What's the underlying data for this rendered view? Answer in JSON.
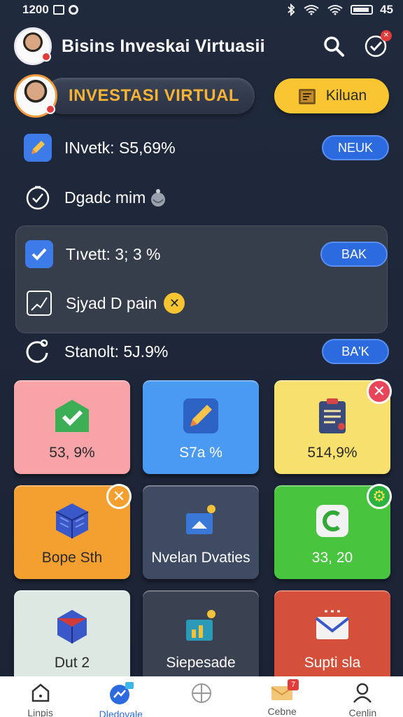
{
  "status_bar": {
    "time": "1200",
    "battery": "45"
  },
  "header": {
    "title": "Bisins Inveskai Virtuasii"
  },
  "banner": {
    "pill_text": "INVESTASI VIRTUAL",
    "button_label": "Kiluan"
  },
  "rows": [
    {
      "label": "INvetk: S5,69%",
      "button": "NEUK"
    },
    {
      "label": "Dgadc mim",
      "button": null
    },
    {
      "label": "Tıvett: 3; 3 %",
      "button": "BAK"
    },
    {
      "label": "Sjyad D pain",
      "button": null
    },
    {
      "label": "Stanolt: 5J.9%",
      "button": "BA'K"
    }
  ],
  "tiles": [
    {
      "label": "53, 9%",
      "color": "#f7a3a8",
      "icon": "envelope-check-icon"
    },
    {
      "label": "S7a %",
      "color": "#4a9af2",
      "icon": "pencil-icon"
    },
    {
      "label": "514,9%",
      "color": "#f8e06e",
      "icon": "clipboard-icon",
      "badge": "✕"
    },
    {
      "label": "Bope Sth",
      "color": "#f4a031",
      "icon": "cube-icon",
      "badge": "✕"
    },
    {
      "label": "Nvelan Dvaties",
      "color": "#3f4a63",
      "icon": "house-chart-icon"
    },
    {
      "label": "33, 20",
      "color": "#49c43f",
      "icon": "refresh-icon",
      "badge": "⚙"
    },
    {
      "label": "Dut 2",
      "color": "#dde8e2",
      "icon": "box-icon"
    },
    {
      "label": "Siepesade",
      "color": "#3a4150",
      "icon": "bar-chart-icon"
    },
    {
      "label": "Supti sla",
      "color": "#d5503a",
      "icon": "mail-icon"
    }
  ],
  "bottom_nav": [
    {
      "label": "Linpis",
      "icon": "home-icon"
    },
    {
      "label": "Dledovale",
      "icon": "chart-bubble-icon",
      "active": true
    },
    {
      "label": "",
      "icon": "globe-icon"
    },
    {
      "label": "Cebne",
      "icon": "mail-icon",
      "badge": "7"
    },
    {
      "label": "Cenlin",
      "icon": "user-icon"
    }
  ]
}
